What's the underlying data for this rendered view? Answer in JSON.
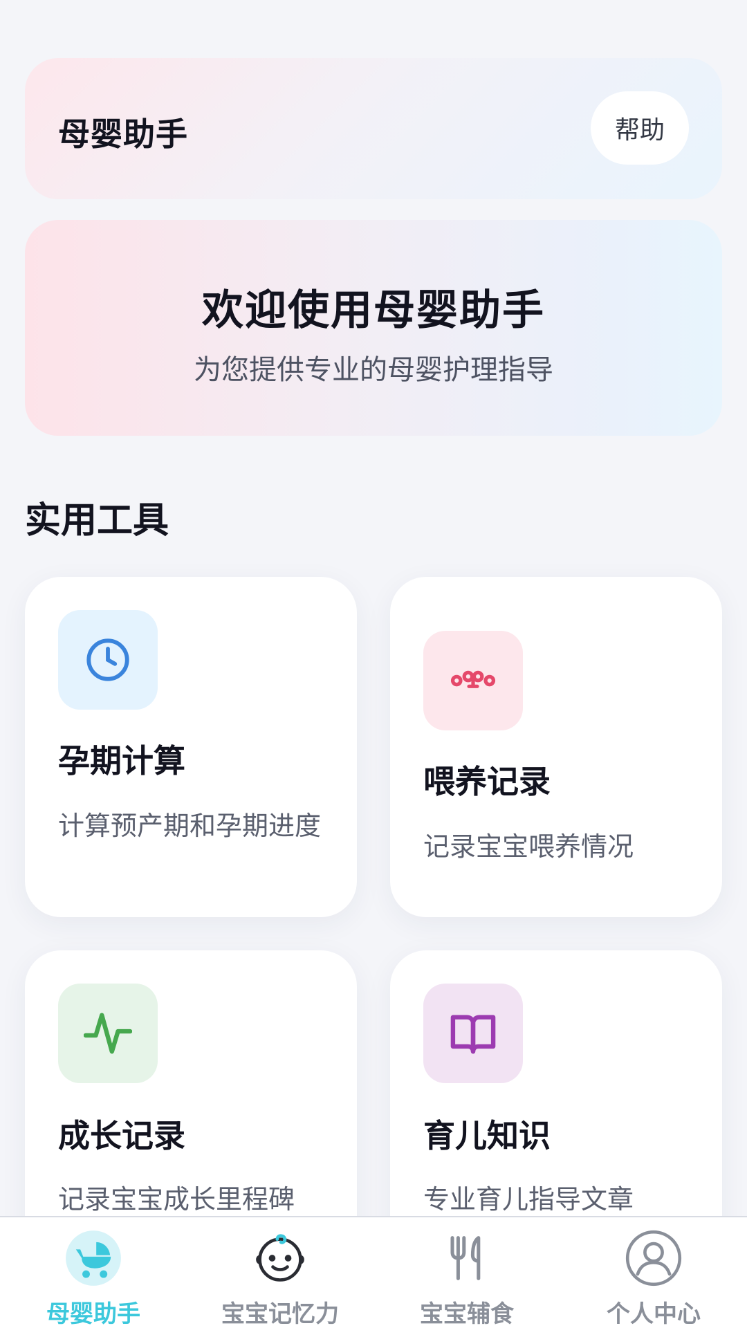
{
  "header": {
    "title": "母婴助手",
    "help_label": "帮助"
  },
  "welcome": {
    "title": "欢迎使用母婴助手",
    "subtitle": "为您提供专业的母婴护理指导"
  },
  "tools": {
    "section_title": "实用工具",
    "items": [
      {
        "title": "孕期计算",
        "desc": "计算预产期和孕期进度",
        "icon": "clock-icon",
        "color": "#3a84dc"
      },
      {
        "title": "喂养记录",
        "desc": "记录宝宝喂养情况",
        "icon": "bottle-icon",
        "color": "#e5486a"
      },
      {
        "title": "成长记录",
        "desc": "记录宝宝成长里程碑",
        "icon": "activity-icon",
        "color": "#46a84e"
      },
      {
        "title": "育儿知识",
        "desc": "专业育儿指导文章",
        "icon": "book-icon",
        "color": "#9c3bb0"
      }
    ]
  },
  "tabbar": {
    "items": [
      {
        "label": "母婴助手",
        "icon": "stroller-icon",
        "active": true
      },
      {
        "label": "宝宝记忆力",
        "icon": "baby-face-icon",
        "active": false
      },
      {
        "label": "宝宝辅食",
        "icon": "fork-knife-icon",
        "active": false
      },
      {
        "label": "个人中心",
        "icon": "user-icon",
        "active": false
      }
    ]
  },
  "colors": {
    "accent": "#3cc8dc",
    "background": "#f4f5f9"
  }
}
